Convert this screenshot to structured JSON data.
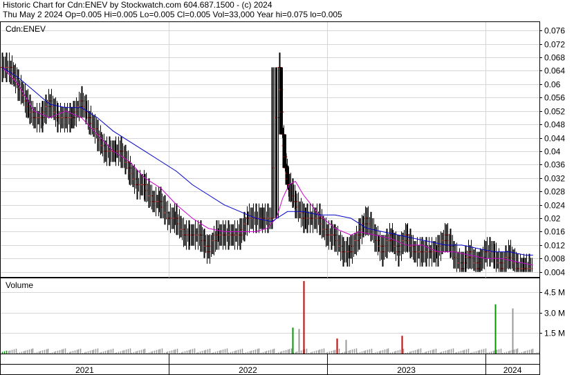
{
  "header": {
    "line1": "Historic Chart for Cdn:ENEV by Stockwatch.com 604.687.1500 - (c) 2024",
    "line2": "Thu May  2 2024  Op=0.005  Hi=0.005  Lo=0.005  Cl=0.005  Vol=33,000  Year hi=0.075  lo=0.005"
  },
  "chart_data": [
    {
      "type": "line",
      "title": "Cdn:ENEV",
      "price_axis_ticks": [
        "0.076",
        "0.072",
        "0.068",
        "0.064",
        "0.06",
        "0.056",
        "0.052",
        "0.048",
        "0.044",
        "0.04",
        "0.036",
        "0.032",
        "0.028",
        "0.024",
        "0.02",
        "0.016",
        "0.012",
        "0.008",
        "0.004"
      ],
      "ylim": [
        0.0025,
        0.0785
      ],
      "xlim": [
        2020.94,
        2024.34
      ],
      "grid": true,
      "bar_color": "#000000",
      "pivot_marker_color": "#cc0000",
      "series": [
        {
          "color": "#000000",
          "x": [
            2020.95,
            2021.0,
            2021.05,
            2021.1,
            2021.15,
            2021.2,
            2021.25,
            2021.3,
            2021.35,
            2021.4,
            2021.45,
            2021.5,
            2021.55,
            2021.6,
            2021.65,
            2021.7,
            2021.75,
            2021.8,
            2021.85,
            2021.9,
            2021.95,
            2022.0,
            2022.05,
            2022.1,
            2022.15,
            2022.2,
            2022.25,
            2022.3,
            2022.35,
            2022.4,
            2022.45,
            2022.5,
            2022.55,
            2022.6,
            2022.65,
            2022.7,
            2022.72,
            2022.74,
            2022.76,
            2022.8,
            2022.85,
            2022.9,
            2022.95,
            2023.0,
            2023.05,
            2023.1,
            2023.15,
            2023.2,
            2023.25,
            2023.3,
            2023.35,
            2023.4,
            2023.45,
            2023.5,
            2023.55,
            2023.6,
            2023.65,
            2023.7,
            2023.75,
            2023.8,
            2023.85,
            2023.9,
            2023.95,
            2024.0,
            2024.05,
            2024.1,
            2024.15,
            2024.2,
            2024.25,
            2024.3
          ],
          "y": [
            0.065,
            0.065,
            0.06,
            0.055,
            0.05,
            0.05,
            0.055,
            0.05,
            0.05,
            0.05,
            0.055,
            0.05,
            0.045,
            0.04,
            0.04,
            0.04,
            0.035,
            0.03,
            0.03,
            0.025,
            0.025,
            0.02,
            0.02,
            0.015,
            0.015,
            0.015,
            0.01,
            0.015,
            0.015,
            0.015,
            0.015,
            0.02,
            0.02,
            0.02,
            0.02,
            0.065,
            0.045,
            0.035,
            0.03,
            0.025,
            0.02,
            0.02,
            0.02,
            0.015,
            0.015,
            0.01,
            0.01,
            0.015,
            0.02,
            0.015,
            0.01,
            0.015,
            0.01,
            0.015,
            0.01,
            0.01,
            0.01,
            0.01,
            0.015,
            0.01,
            0.005,
            0.01,
            0.005,
            0.01,
            0.01,
            0.005,
            0.01,
            0.005,
            0.005,
            0.005
          ]
        },
        {
          "color": "#cc00cc",
          "x": [
            2020.95,
            2021.05,
            2021.15,
            2021.25,
            2021.35,
            2021.45,
            2021.55,
            2021.65,
            2021.75,
            2021.85,
            2021.95,
            2022.05,
            2022.15,
            2022.25,
            2022.35,
            2022.45,
            2022.55,
            2022.62,
            2022.68,
            2022.72,
            2022.76,
            2022.8,
            2022.85,
            2022.9,
            2022.95,
            2023.0,
            2023.05,
            2023.1,
            2023.15,
            2023.2,
            2023.3,
            2023.4,
            2023.5,
            2023.6,
            2023.7,
            2023.8,
            2023.9,
            2024.0,
            2024.1,
            2024.2,
            2024.3
          ],
          "y": [
            0.065,
            0.06,
            0.052,
            0.05,
            0.052,
            0.05,
            0.045,
            0.04,
            0.037,
            0.032,
            0.029,
            0.024,
            0.02,
            0.017,
            0.016,
            0.016,
            0.016,
            0.017,
            0.02,
            0.026,
            0.03,
            0.031,
            0.027,
            0.024,
            0.021,
            0.019,
            0.017,
            0.016,
            0.015,
            0.016,
            0.015,
            0.014,
            0.012,
            0.012,
            0.01,
            0.01,
            0.009,
            0.008,
            0.008,
            0.007,
            0.006
          ]
        },
        {
          "color": "#0000cc",
          "x": [
            2020.95,
            2021.05,
            2021.15,
            2021.25,
            2021.35,
            2021.45,
            2021.55,
            2021.65,
            2021.75,
            2021.85,
            2021.95,
            2022.05,
            2022.15,
            2022.25,
            2022.35,
            2022.45,
            2022.55,
            2022.65,
            2022.75,
            2022.85,
            2022.95,
            2023.05,
            2023.15,
            2023.25,
            2023.35,
            2023.45,
            2023.55,
            2023.65,
            2023.75,
            2023.85,
            2023.95,
            2024.05,
            2024.15,
            2024.25,
            2024.3
          ],
          "y": [
            0.065,
            0.062,
            0.058,
            0.054,
            0.053,
            0.053,
            0.05,
            0.046,
            0.043,
            0.04,
            0.037,
            0.034,
            0.03,
            0.027,
            0.024,
            0.022,
            0.02,
            0.019,
            0.022,
            0.022,
            0.021,
            0.021,
            0.02,
            0.017,
            0.016,
            0.015,
            0.014,
            0.013,
            0.012,
            0.012,
            0.011,
            0.01,
            0.01,
            0.009,
            0.009
          ]
        }
      ]
    },
    {
      "type": "bar",
      "title": "Volume",
      "volume_axis_ticks": [
        "4.5 M",
        "3.0 M",
        "1.5 M"
      ],
      "volume_tick_values": [
        4.5,
        3.0,
        1.5
      ],
      "unit": "M",
      "ylim": [
        0,
        5.5
      ],
      "notable_values": [
        {
          "x": 2022.85,
          "value": 5.3,
          "color": "#cc0000"
        },
        {
          "x": 2024.06,
          "value": 3.6,
          "color": "#009900"
        },
        {
          "x": 2024.17,
          "value": 3.3,
          "color": "#999999"
        },
        {
          "x": 2022.78,
          "value": 1.9,
          "color": "#009900"
        },
        {
          "x": 2022.82,
          "value": 1.8,
          "color": "#999999"
        },
        {
          "x": 2023.47,
          "value": 1.3,
          "color": "#cc0000"
        },
        {
          "x": 2023.06,
          "value": 1.1,
          "color": "#cc0000"
        },
        {
          "x": 2023.12,
          "value": 1.0,
          "color": "#999999"
        }
      ],
      "colors": {
        "up": "#009900",
        "down": "#cc0000",
        "flat": "#999999"
      }
    }
  ],
  "time_axis": {
    "year_labels": [
      {
        "label": "2021",
        "start": 2020.94,
        "end": 2022.0
      },
      {
        "label": "2022",
        "start": 2022.0,
        "end": 2023.0
      },
      {
        "label": "2023",
        "start": 2023.0,
        "end": 2024.0
      },
      {
        "label": "2024",
        "start": 2024.0,
        "end": 2024.34
      }
    ]
  }
}
